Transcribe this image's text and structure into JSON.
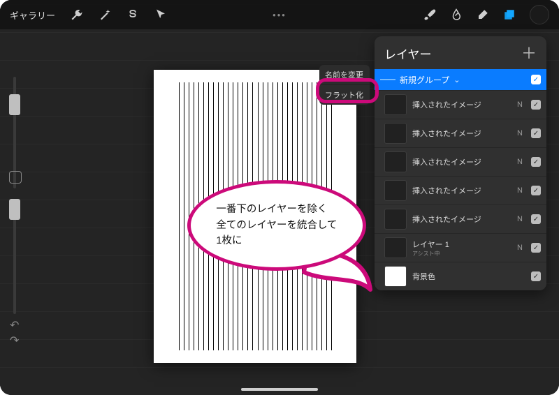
{
  "topbar": {
    "gallery_label": "ギャラリー",
    "ellipsis": "•••"
  },
  "context_menu": {
    "rename": "名前を変更",
    "flatten": "フラット化"
  },
  "layers_panel": {
    "title": "レイヤー",
    "group_label": "新規グループ",
    "inserted_image_label": "挿入されたイメージ",
    "blend_normal": "N",
    "layer1_label": "レイヤー 1",
    "layer1_sub": "アシスト中",
    "background_label": "背景色"
  },
  "annotation": {
    "line1": "一番下のレイヤーを除く",
    "line2": "全てのレイヤーを統合して",
    "line3": "1枚に"
  },
  "colors": {
    "accent_pink": "#cc0a7a",
    "primary_blue": "#0a7cff"
  }
}
